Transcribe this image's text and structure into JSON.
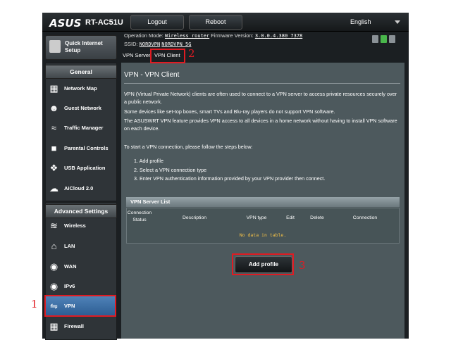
{
  "header": {
    "brand": "ASUS",
    "model": "RT-AC51U",
    "logout_label": "Logout",
    "reboot_label": "Reboot",
    "language": "English"
  },
  "status": {
    "operation_mode_label": "Operation Mode:",
    "operation_mode": "Wireless router",
    "firmware_label": "Firmware Version:",
    "firmware": "3.0.0.4.380_7378",
    "ssid_label": "SSID:",
    "ssid_1": "NORDVPN",
    "ssid_2": "NORDVPN_5G"
  },
  "sidebar": {
    "quick_setup": "Quick Internet Setup",
    "general_header": "General",
    "general_items": [
      {
        "label": "Network Map",
        "icon": "network-map-icon"
      },
      {
        "label": "Guest Network",
        "icon": "guest-network-icon"
      },
      {
        "label": "Traffic Manager",
        "icon": "traffic-manager-icon"
      },
      {
        "label": "Parental Controls",
        "icon": "parental-controls-icon"
      },
      {
        "label": "USB Application",
        "icon": "usb-application-icon"
      },
      {
        "label": "AiCloud 2.0",
        "icon": "aicloud-icon"
      }
    ],
    "advanced_header": "Advanced Settings",
    "advanced_items": [
      {
        "label": "Wireless",
        "icon": "wireless-icon"
      },
      {
        "label": "LAN",
        "icon": "lan-icon"
      },
      {
        "label": "WAN",
        "icon": "wan-icon"
      },
      {
        "label": "IPv6",
        "icon": "ipv6-icon"
      },
      {
        "label": "VPN",
        "icon": "vpn-icon"
      },
      {
        "label": "Firewall",
        "icon": "firewall-icon"
      }
    ]
  },
  "tabs": {
    "vpn_server": "VPN Server",
    "vpn_client": "VPN Client"
  },
  "main": {
    "title": "VPN - VPN Client",
    "para1": "VPN (Virtual Private Network) clients are often used to connect to a VPN server to access private resources securely over a public network.",
    "para2": "Some devices like set-top boxes, smart TVs and Blu-ray players do not support VPN software.",
    "para3": "The ASUSWRT VPN feature provides VPN access to all devices in a home network without having to install VPN software on each device.",
    "steps_intro": "To start a VPN connection, please follow the steps below:",
    "step1": "1. Add profile",
    "step2": "2. Select a VPN connection type",
    "step3": "3. Enter VPN authentication information provided by your VPN provider then connect.",
    "table_title": "VPN Server List",
    "columns": [
      "Connection Status",
      "Description",
      "VPN type",
      "Edit",
      "Delete",
      "Connection"
    ],
    "empty_text": "No data in table.",
    "add_profile": "Add profile"
  },
  "annotations": {
    "label_1": "1",
    "label_2": "2",
    "label_3": "3",
    "highlight_color": "#e01b22"
  },
  "colors": {
    "panel": "#4d595d",
    "active_item": "#3d70a6",
    "empty_text": "#f5c247"
  }
}
